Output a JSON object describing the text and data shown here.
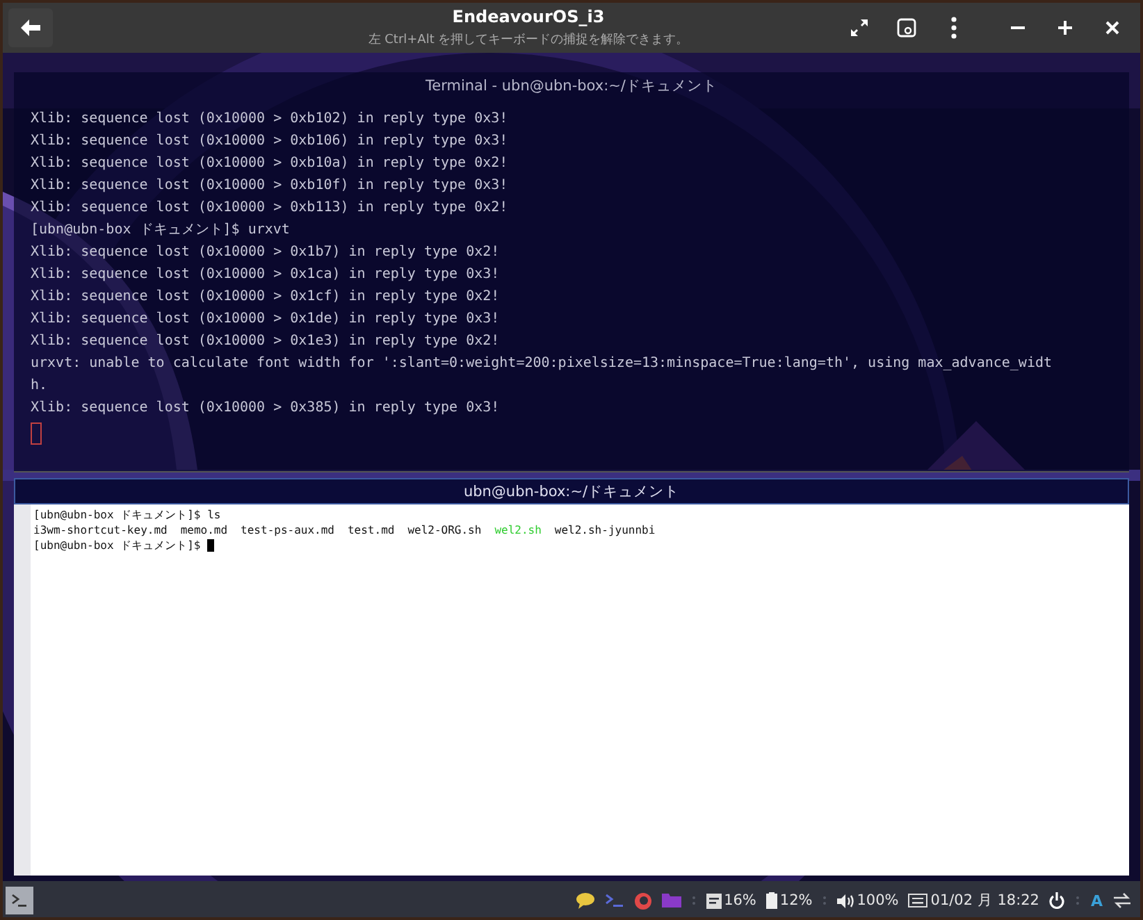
{
  "window": {
    "title": "EndeavourOS_i3",
    "subtitle": "左  Ctrl+Alt を押してキーボードの捕捉を解除できます。"
  },
  "top_terminal": {
    "title": "Terminal - ubn@ubn-box:~/ドキュメント",
    "lines": [
      "Xlib: sequence lost (0x10000 > 0xb102) in reply type 0x3!",
      "Xlib: sequence lost (0x10000 > 0xb106) in reply type 0x3!",
      "Xlib: sequence lost (0x10000 > 0xb10a) in reply type 0x2!",
      "Xlib: sequence lost (0x10000 > 0xb10f) in reply type 0x3!",
      "Xlib: sequence lost (0x10000 > 0xb113) in reply type 0x2!",
      "[ubn@ubn-box ドキュメント]$ urxvt",
      "Xlib: sequence lost (0x10000 > 0x1b7) in reply type 0x2!",
      "Xlib: sequence lost (0x10000 > 0x1ca) in reply type 0x3!",
      "Xlib: sequence lost (0x10000 > 0x1cf) in reply type 0x2!",
      "Xlib: sequence lost (0x10000 > 0x1de) in reply type 0x3!",
      "Xlib: sequence lost (0x10000 > 0x1e3) in reply type 0x2!",
      "urxvt: unable to calculate font width for ':slant=0:weight=200:pixelsize=13:minspace=True:lang=th', using max_advance_widt",
      "h.",
      "Xlib: sequence lost (0x10000 > 0x385) in reply type 0x3!"
    ]
  },
  "bottom_terminal": {
    "title": "ubn@ubn-box:~/ドキュメント",
    "lines": [
      {
        "kind": "command",
        "text": "[ubn@ubn-box ドキュメント]$ ls"
      },
      {
        "kind": "listing",
        "files": [
          {
            "name": "i3wm-shortcut-key.md",
            "kind": "file"
          },
          {
            "name": "memo.md",
            "kind": "file"
          },
          {
            "name": "test-ps-aux.md",
            "kind": "file"
          },
          {
            "name": "test.md",
            "kind": "file"
          },
          {
            "name": "wel2-ORG.sh",
            "kind": "file"
          },
          {
            "name": "wel2.sh",
            "kind": "executable"
          },
          {
            "name": "wel2.sh-jyunnbi",
            "kind": "file"
          }
        ]
      },
      {
        "kind": "prompt",
        "text": "[ubn@ubn-box ドキュメント]$"
      }
    ]
  },
  "taskbar": {
    "memory": "16%",
    "battery": "12%",
    "volume": "100%",
    "clock": "01/02 月 18:22",
    "layout": "A"
  }
}
